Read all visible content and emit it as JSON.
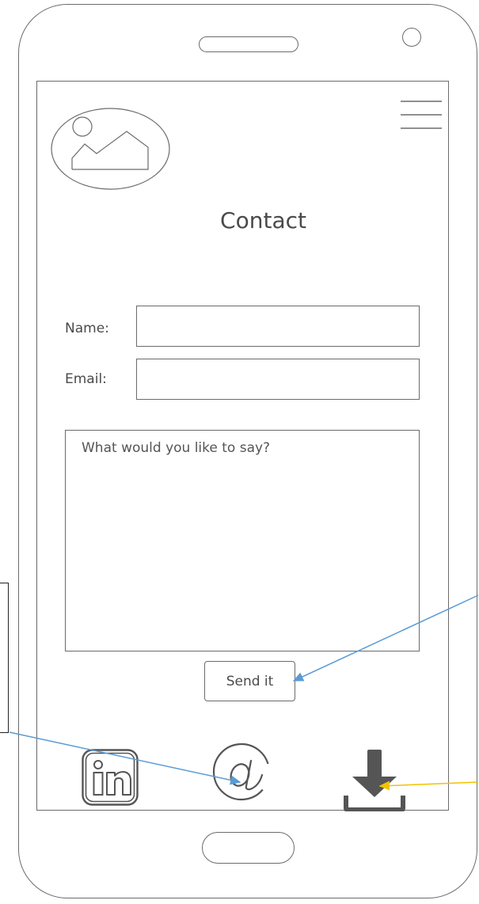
{
  "page": {
    "title": "Contact"
  },
  "form": {
    "name_label": "Name:",
    "name_value": "",
    "email_label": "Email:",
    "email_value": "",
    "message_placeholder": "What would you like to say?",
    "send_label": "Send it"
  },
  "footer_icons": [
    "linkedin-icon",
    "at-email-icon",
    "download-icon"
  ],
  "colors": {
    "outline": "#6b6b6b",
    "text": "#4a4a4a",
    "annotation_blue": "#5b9bd5",
    "annotation_yellow": "#f2c200",
    "download_icon": "#555555"
  }
}
